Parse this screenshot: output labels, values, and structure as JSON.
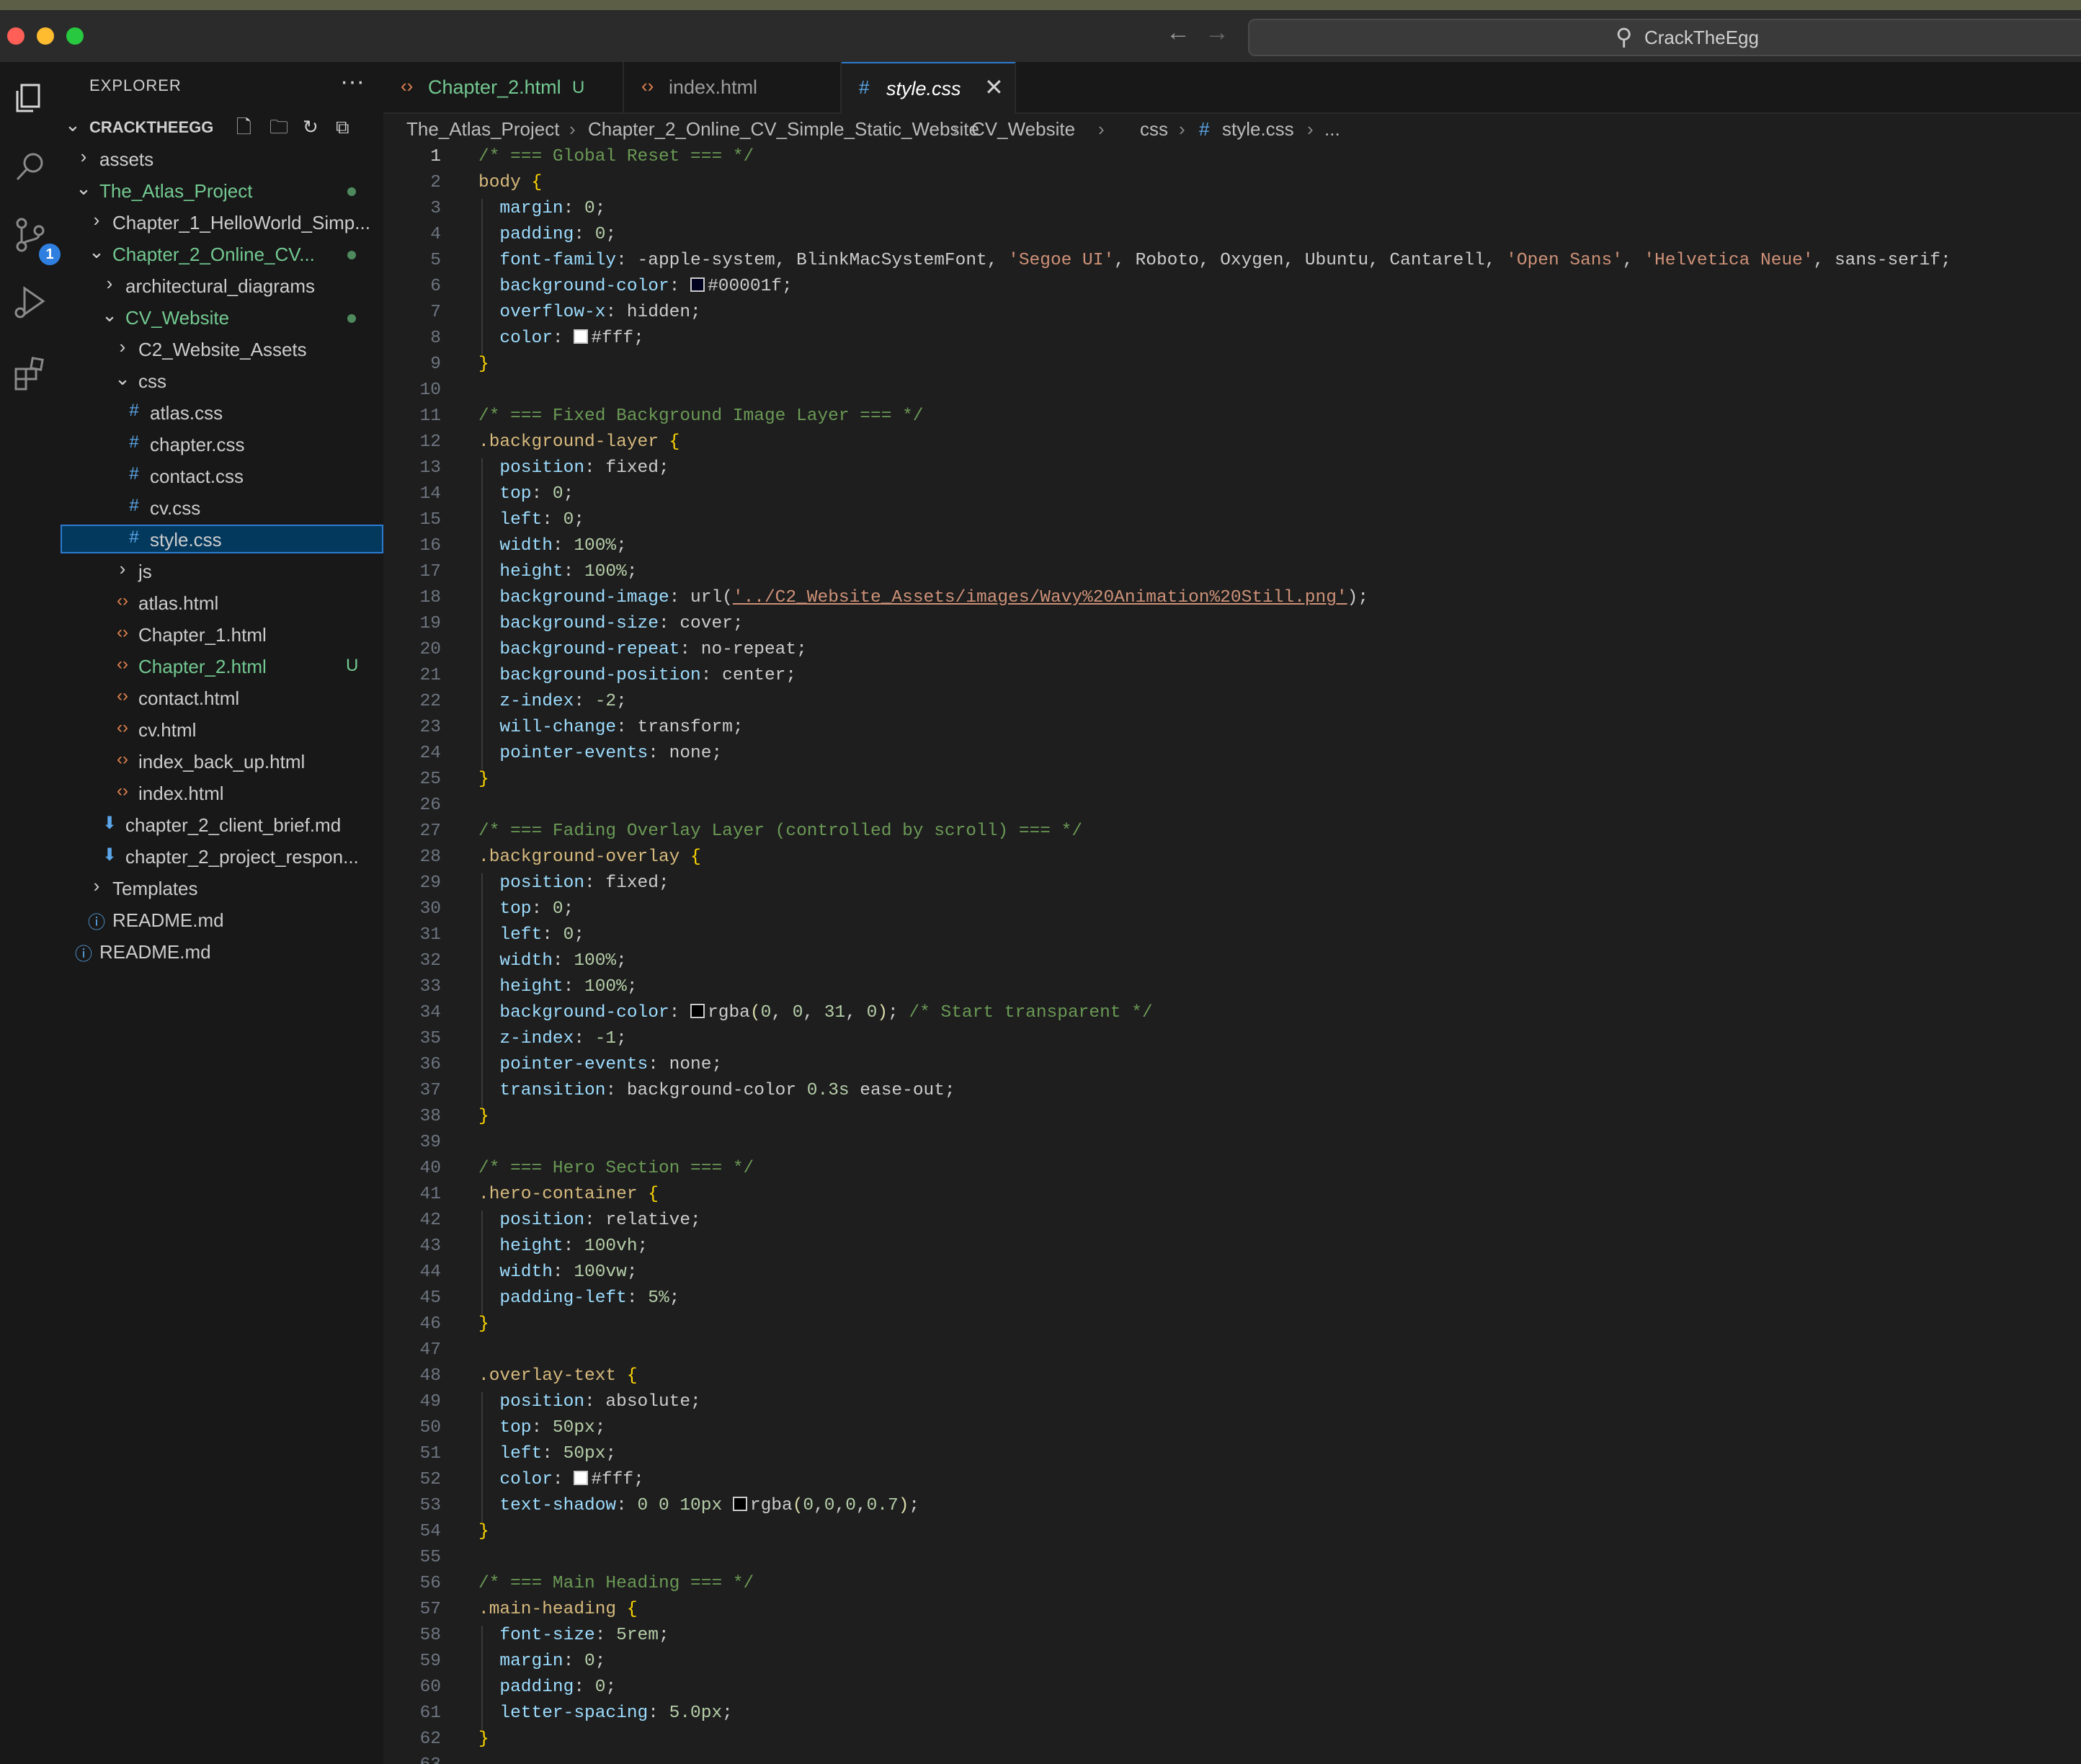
{
  "titlebar": {
    "search_label": "CrackTheEgg",
    "icons": {
      "back": "arrow-left-icon",
      "forward": "arrow-right-icon",
      "search": "search-icon"
    }
  },
  "activity_bar": {
    "items": [
      "explorer-icon",
      "search-icon",
      "source-control-icon",
      "run-debug-icon",
      "extensions-icon"
    ],
    "source_control_badge": "1"
  },
  "sidebar": {
    "header": "EXPLORER",
    "more": "···",
    "root": "CRACKTHEEGG",
    "tree": [
      {
        "label": "assets",
        "type": "folder",
        "expanded": false,
        "depth": 1
      },
      {
        "label": "The_Atlas_Project",
        "type": "folder",
        "expanded": true,
        "depth": 1,
        "git": "modified"
      },
      {
        "label": "Chapter_1_HelloWorld_Simp...",
        "type": "folder",
        "expanded": false,
        "depth": 2
      },
      {
        "label": "Chapter_2_Online_CV...",
        "type": "folder",
        "expanded": true,
        "depth": 2,
        "git": "modified"
      },
      {
        "label": "architectural_diagrams",
        "type": "folder",
        "expanded": false,
        "depth": 3
      },
      {
        "label": "CV_Website",
        "type": "folder",
        "expanded": true,
        "depth": 3,
        "git": "modified"
      },
      {
        "label": "C2_Website_Assets",
        "type": "folder",
        "expanded": false,
        "depth": 4
      },
      {
        "label": "css",
        "type": "folder",
        "expanded": true,
        "depth": 4
      },
      {
        "label": "atlas.css",
        "type": "css",
        "depth": 5
      },
      {
        "label": "chapter.css",
        "type": "css",
        "depth": 5
      },
      {
        "label": "contact.css",
        "type": "css",
        "depth": 5
      },
      {
        "label": "cv.css",
        "type": "css",
        "depth": 5
      },
      {
        "label": "style.css",
        "type": "css",
        "depth": 5,
        "selected": true
      },
      {
        "label": "js",
        "type": "folder",
        "expanded": false,
        "depth": 4
      },
      {
        "label": "atlas.html",
        "type": "html",
        "depth": 4
      },
      {
        "label": "Chapter_1.html",
        "type": "html",
        "depth": 4
      },
      {
        "label": "Chapter_2.html",
        "type": "html",
        "depth": 4,
        "git": "untracked",
        "badge": "U"
      },
      {
        "label": "contact.html",
        "type": "html",
        "depth": 4
      },
      {
        "label": "cv.html",
        "type": "html",
        "depth": 4
      },
      {
        "label": "index_back_up.html",
        "type": "html",
        "depth": 4
      },
      {
        "label": "index.html",
        "type": "html",
        "depth": 4
      },
      {
        "label": "chapter_2_client_brief.md",
        "type": "md",
        "depth": 3
      },
      {
        "label": "chapter_2_project_respon...",
        "type": "md",
        "depth": 3
      },
      {
        "label": "Templates",
        "type": "folder",
        "expanded": false,
        "depth": 2
      },
      {
        "label": "README.md",
        "type": "info",
        "depth": 2
      },
      {
        "label": "README.md",
        "type": "info",
        "depth": 1
      }
    ]
  },
  "tabs": [
    {
      "label": "Chapter_2.html",
      "status": "U",
      "icon": "html-icon",
      "active": false
    },
    {
      "label": "index.html",
      "icon": "html-icon",
      "active": false
    },
    {
      "label": "style.css",
      "icon": "css-hash-icon",
      "active": true,
      "close": "✕"
    }
  ],
  "breadcrumb": [
    "The_Atlas_Project",
    "Chapter_2_Online_CV_Simple_Static_Website",
    "CV_Website",
    "css",
    "style.css",
    "..."
  ],
  "editor": {
    "current_line": 1,
    "lines": [
      [
        [
          "c",
          "/* === Global Reset === */"
        ]
      ],
      [
        [
          "s",
          "body "
        ],
        [
          "b",
          "{"
        ]
      ],
      [
        [
          "i",
          "  "
        ],
        [
          "p",
          "margin"
        ],
        [
          "t",
          ": "
        ],
        [
          "n",
          "0"
        ],
        [
          "t",
          ";"
        ]
      ],
      [
        [
          "i",
          "  "
        ],
        [
          "p",
          "padding"
        ],
        [
          "t",
          ": "
        ],
        [
          "n",
          "0"
        ],
        [
          "t",
          ";"
        ]
      ],
      [
        [
          "i",
          "  "
        ],
        [
          "p",
          "font-family"
        ],
        [
          "t",
          ": -apple-system, BlinkMacSystemFont, "
        ],
        [
          "str",
          "'Segoe UI'"
        ],
        [
          "t",
          ", Roboto, Oxygen, Ubuntu, Cantarell, "
        ],
        [
          "str",
          "'Open Sans'"
        ],
        [
          "t",
          ", "
        ],
        [
          "str",
          "'Helvetica Neue'"
        ],
        [
          "t",
          ", sans-serif;"
        ]
      ],
      [
        [
          "i",
          "  "
        ],
        [
          "p",
          "background-color"
        ],
        [
          "t",
          ": "
        ],
        [
          "sw",
          "dark"
        ],
        [
          "t",
          "#00001f;"
        ]
      ],
      [
        [
          "i",
          "  "
        ],
        [
          "p",
          "overflow-x"
        ],
        [
          "t",
          ": hidden;"
        ]
      ],
      [
        [
          "i",
          "  "
        ],
        [
          "p",
          "color"
        ],
        [
          "t",
          ": "
        ],
        [
          "sw",
          "white"
        ],
        [
          "t",
          "#fff;"
        ]
      ],
      [
        [
          "b",
          "}"
        ]
      ],
      [],
      [
        [
          "c",
          "/* === Fixed Background Image Layer === */"
        ]
      ],
      [
        [
          "s",
          ".background-layer "
        ],
        [
          "b",
          "{"
        ]
      ],
      [
        [
          "i",
          "  "
        ],
        [
          "p",
          "position"
        ],
        [
          "t",
          ": fixed;"
        ]
      ],
      [
        [
          "i",
          "  "
        ],
        [
          "p",
          "top"
        ],
        [
          "t",
          ": "
        ],
        [
          "n",
          "0"
        ],
        [
          "t",
          ";"
        ]
      ],
      [
        [
          "i",
          "  "
        ],
        [
          "p",
          "left"
        ],
        [
          "t",
          ": "
        ],
        [
          "n",
          "0"
        ],
        [
          "t",
          ";"
        ]
      ],
      [
        [
          "i",
          "  "
        ],
        [
          "p",
          "width"
        ],
        [
          "t",
          ": "
        ],
        [
          "n",
          "100%"
        ],
        [
          "t",
          ";"
        ]
      ],
      [
        [
          "i",
          "  "
        ],
        [
          "p",
          "height"
        ],
        [
          "t",
          ": "
        ],
        [
          "n",
          "100%"
        ],
        [
          "t",
          ";"
        ]
      ],
      [
        [
          "i",
          "  "
        ],
        [
          "p",
          "background-image"
        ],
        [
          "t",
          ": url("
        ],
        [
          "u",
          "'../C2_Website_Assets/images/Wavy%20Animation%20Still.png'"
        ],
        [
          "t",
          ");"
        ]
      ],
      [
        [
          "i",
          "  "
        ],
        [
          "p",
          "background-size"
        ],
        [
          "t",
          ": cover;"
        ]
      ],
      [
        [
          "i",
          "  "
        ],
        [
          "p",
          "background-repeat"
        ],
        [
          "t",
          ": no-repeat;"
        ]
      ],
      [
        [
          "i",
          "  "
        ],
        [
          "p",
          "background-position"
        ],
        [
          "t",
          ": center;"
        ]
      ],
      [
        [
          "i",
          "  "
        ],
        [
          "p",
          "z-index"
        ],
        [
          "t",
          ": "
        ],
        [
          "n",
          "-2"
        ],
        [
          "t",
          ";"
        ]
      ],
      [
        [
          "i",
          "  "
        ],
        [
          "p",
          "will-change"
        ],
        [
          "t",
          ": transform;"
        ]
      ],
      [
        [
          "i",
          "  "
        ],
        [
          "p",
          "pointer-events"
        ],
        [
          "t",
          ": none;"
        ]
      ],
      [
        [
          "b",
          "}"
        ]
      ],
      [],
      [
        [
          "c",
          "/* === Fading Overlay Layer (controlled by scroll) === */"
        ]
      ],
      [
        [
          "s",
          ".background-overlay "
        ],
        [
          "b",
          "{"
        ]
      ],
      [
        [
          "i",
          "  "
        ],
        [
          "p",
          "position"
        ],
        [
          "t",
          ": fixed;"
        ]
      ],
      [
        [
          "i",
          "  "
        ],
        [
          "p",
          "top"
        ],
        [
          "t",
          ": "
        ],
        [
          "n",
          "0"
        ],
        [
          "t",
          ";"
        ]
      ],
      [
        [
          "i",
          "  "
        ],
        [
          "p",
          "left"
        ],
        [
          "t",
          ": "
        ],
        [
          "n",
          "0"
        ],
        [
          "t",
          ";"
        ]
      ],
      [
        [
          "i",
          "  "
        ],
        [
          "p",
          "width"
        ],
        [
          "t",
          ": "
        ],
        [
          "n",
          "100%"
        ],
        [
          "t",
          ";"
        ]
      ],
      [
        [
          "i",
          "  "
        ],
        [
          "p",
          "height"
        ],
        [
          "t",
          ": "
        ],
        [
          "n",
          "100%"
        ],
        [
          "t",
          ";"
        ]
      ],
      [
        [
          "i",
          "  "
        ],
        [
          "p",
          "background-color"
        ],
        [
          "t",
          ": "
        ],
        [
          "sw",
          "black"
        ],
        [
          "t",
          "rgba"
        ],
        [
          "f",
          "("
        ],
        [
          "n",
          "0"
        ],
        [
          "t",
          ", "
        ],
        [
          "n",
          "0"
        ],
        [
          "t",
          ", "
        ],
        [
          "n",
          "31"
        ],
        [
          "t",
          ", "
        ],
        [
          "n",
          "0"
        ],
        [
          "f",
          ")"
        ],
        [
          "t",
          "; "
        ],
        [
          "c",
          "/* Start transparent */"
        ]
      ],
      [
        [
          "i",
          "  "
        ],
        [
          "p",
          "z-index"
        ],
        [
          "t",
          ": "
        ],
        [
          "n",
          "-1"
        ],
        [
          "t",
          ";"
        ]
      ],
      [
        [
          "i",
          "  "
        ],
        [
          "p",
          "pointer-events"
        ],
        [
          "t",
          ": none;"
        ]
      ],
      [
        [
          "i",
          "  "
        ],
        [
          "p",
          "transition"
        ],
        [
          "t",
          ": background-color "
        ],
        [
          "n",
          "0.3s"
        ],
        [
          "t",
          " ease-out;"
        ]
      ],
      [
        [
          "b",
          "}"
        ]
      ],
      [],
      [
        [
          "c",
          "/* === Hero Section === */"
        ]
      ],
      [
        [
          "s",
          ".hero-container "
        ],
        [
          "b",
          "{"
        ]
      ],
      [
        [
          "i",
          "  "
        ],
        [
          "p",
          "position"
        ],
        [
          "t",
          ": relative;"
        ]
      ],
      [
        [
          "i",
          "  "
        ],
        [
          "p",
          "height"
        ],
        [
          "t",
          ": "
        ],
        [
          "n",
          "100vh"
        ],
        [
          "t",
          ";"
        ]
      ],
      [
        [
          "i",
          "  "
        ],
        [
          "p",
          "width"
        ],
        [
          "t",
          ": "
        ],
        [
          "n",
          "100vw"
        ],
        [
          "t",
          ";"
        ]
      ],
      [
        [
          "i",
          "  "
        ],
        [
          "p",
          "padding-left"
        ],
        [
          "t",
          ": "
        ],
        [
          "n",
          "5%"
        ],
        [
          "t",
          ";"
        ]
      ],
      [
        [
          "b",
          "}"
        ]
      ],
      [],
      [
        [
          "s",
          ".overlay-text "
        ],
        [
          "b",
          "{"
        ]
      ],
      [
        [
          "i",
          "  "
        ],
        [
          "p",
          "position"
        ],
        [
          "t",
          ": absolute;"
        ]
      ],
      [
        [
          "i",
          "  "
        ],
        [
          "p",
          "top"
        ],
        [
          "t",
          ": "
        ],
        [
          "n",
          "50px"
        ],
        [
          "t",
          ";"
        ]
      ],
      [
        [
          "i",
          "  "
        ],
        [
          "p",
          "left"
        ],
        [
          "t",
          ": "
        ],
        [
          "n",
          "50px"
        ],
        [
          "t",
          ";"
        ]
      ],
      [
        [
          "i",
          "  "
        ],
        [
          "p",
          "color"
        ],
        [
          "t",
          ": "
        ],
        [
          "sw",
          "white"
        ],
        [
          "t",
          "#fff;"
        ]
      ],
      [
        [
          "i",
          "  "
        ],
        [
          "p",
          "text-shadow"
        ],
        [
          "t",
          ": "
        ],
        [
          "n",
          "0 0 10px"
        ],
        [
          "t",
          " "
        ],
        [
          "sw",
          "black"
        ],
        [
          "t",
          "rgba"
        ],
        [
          "f",
          "("
        ],
        [
          "n",
          "0"
        ],
        [
          "t",
          ","
        ],
        [
          "n",
          "0"
        ],
        [
          "t",
          ","
        ],
        [
          "n",
          "0"
        ],
        [
          "t",
          ","
        ],
        [
          "n",
          "0.7"
        ],
        [
          "f",
          ")"
        ],
        [
          "t",
          ";"
        ]
      ],
      [
        [
          "b",
          "}"
        ]
      ],
      [],
      [
        [
          "c",
          "/* === Main Heading === */"
        ]
      ],
      [
        [
          "s",
          ".main-heading "
        ],
        [
          "b",
          "{"
        ]
      ],
      [
        [
          "i",
          "  "
        ],
        [
          "p",
          "font-size"
        ],
        [
          "t",
          ": "
        ],
        [
          "n",
          "5rem"
        ],
        [
          "t",
          ";"
        ]
      ],
      [
        [
          "i",
          "  "
        ],
        [
          "p",
          "margin"
        ],
        [
          "t",
          ": "
        ],
        [
          "n",
          "0"
        ],
        [
          "t",
          ";"
        ]
      ],
      [
        [
          "i",
          "  "
        ],
        [
          "p",
          "padding"
        ],
        [
          "t",
          ": "
        ],
        [
          "n",
          "0"
        ],
        [
          "t",
          ";"
        ]
      ],
      [
        [
          "i",
          "  "
        ],
        [
          "p",
          "letter-spacing"
        ],
        [
          "t",
          ": "
        ],
        [
          "n",
          "5.0px"
        ],
        [
          "t",
          ";"
        ]
      ],
      [
        [
          "b",
          "}"
        ]
      ],
      []
    ]
  }
}
